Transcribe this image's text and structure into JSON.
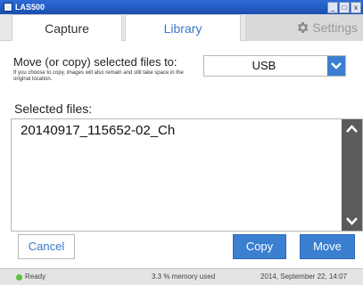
{
  "window": {
    "title": "LAS500",
    "controls": [
      "_",
      "□",
      "x"
    ]
  },
  "tabs": [
    {
      "label": "Capture"
    },
    {
      "label": "Library"
    },
    {
      "label": "Settings"
    }
  ],
  "move": {
    "label": "Move (or copy) selected files to:",
    "note": "If you choose to copy, images will also remain and still take space in the original location.",
    "destination": "USB"
  },
  "selected": {
    "label": "Selected files:",
    "files": [
      "20140917_115652-02_Ch"
    ]
  },
  "buttons": {
    "cancel": "Cancel",
    "copy": "Copy",
    "move": "Move"
  },
  "status": {
    "ready": "Ready",
    "memory": "3.3 % memory used",
    "datetime": "2014, September 22, 14:07"
  },
  "colors": {
    "accent": "#3a7fd0",
    "titlebar": "#1a4fb0",
    "scrollbar": "#5b5b5b",
    "ready": "#5bbf3a"
  }
}
